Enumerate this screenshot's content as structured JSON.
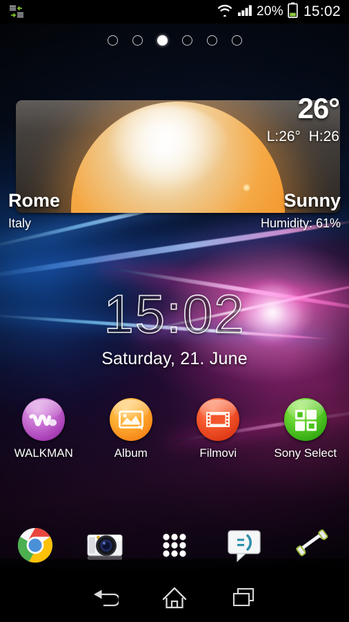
{
  "status_bar": {
    "sync_icon": "sync-transfer-icon",
    "wifi_icon": "wifi-icon",
    "signal_icon": "cellular-signal-icon",
    "battery_percent": "20%",
    "battery_icon": "battery-icon",
    "clock": "15:02"
  },
  "page_indicator": {
    "total": 6,
    "active_index": 2
  },
  "weather_widget": {
    "temperature": "26°",
    "high_low": "L:26°  H:26",
    "city": "Rome",
    "country": "Italy",
    "condition": "Sunny",
    "humidity": "Humidity: 61%",
    "condition_icon": "sun-icon"
  },
  "clock_widget": {
    "time": "15:02",
    "date": "Saturday, 21. June"
  },
  "apps": [
    {
      "label": "WALKMAN",
      "icon": "walkman-icon",
      "color": "#c86fd2"
    },
    {
      "label": "Album",
      "icon": "album-icon",
      "color": "#ffae32"
    },
    {
      "label": "Filmovi",
      "icon": "filmovi-icon",
      "color": "#f4562c"
    },
    {
      "label": "Sony Select",
      "icon": "sony-select-icon",
      "color": "#5fce2a"
    }
  ],
  "dock": [
    {
      "name": "chrome-icon",
      "label": "Chrome"
    },
    {
      "name": "camera-icon",
      "label": "Camera"
    },
    {
      "name": "app-drawer-icon",
      "label": "Apps"
    },
    {
      "name": "messaging-icon",
      "label": "Messaging"
    },
    {
      "name": "phone-icon",
      "label": "Phone"
    }
  ],
  "nav_bar": [
    {
      "name": "back-button",
      "label": "Back"
    },
    {
      "name": "home-button",
      "label": "Home"
    },
    {
      "name": "recents-button",
      "label": "Recent apps"
    }
  ]
}
